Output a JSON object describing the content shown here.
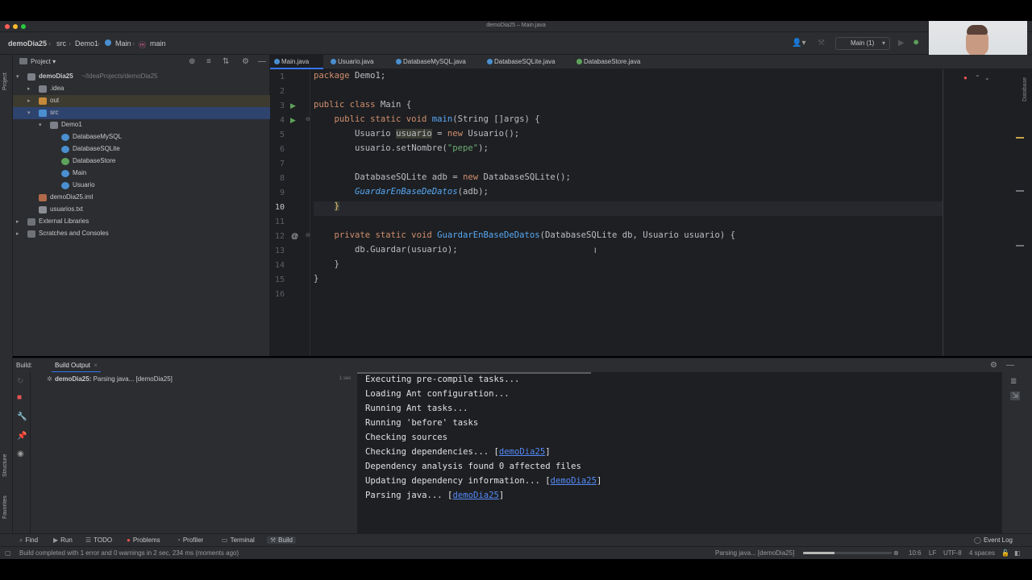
{
  "window": {
    "title": "demoDia25 – Main.java"
  },
  "navbar": {
    "breadcrumbs": [
      "demoDia25",
      "src",
      "Demo1",
      "Main",
      "main"
    ],
    "run_config": "Main (1)"
  },
  "left_strip": {
    "top_labels": [
      "Project"
    ],
    "bottom_labels": [
      "Structure",
      "Favorites"
    ]
  },
  "right_strip": {
    "labels": [
      "Database"
    ]
  },
  "project_panel": {
    "title": "Project",
    "tree": [
      {
        "label": "demoDia25",
        "sub": "~/IdeaProjects/demoDia25",
        "icon": "folder-icon"
      },
      {
        "label": ".idea",
        "icon": "folder-icon"
      },
      {
        "label": "out",
        "icon": "folder-icon"
      },
      {
        "label": "src",
        "icon": "folder-icon"
      },
      {
        "label": "Demo1",
        "icon": "package-icon"
      },
      {
        "label": "DatabaseMySQL",
        "icon": "class-icon"
      },
      {
        "label": "DatabaseSQLite",
        "icon": "class-icon"
      },
      {
        "label": "DatabaseStore",
        "icon": "interface-icon"
      },
      {
        "label": "Main",
        "icon": "class-icon"
      },
      {
        "label": "Usuario",
        "icon": "class-icon"
      },
      {
        "label": "demoDia25.iml",
        "icon": "module-file-icon"
      },
      {
        "label": "usuarios.txt",
        "icon": "text-file-icon"
      },
      {
        "label": "External Libraries",
        "icon": "library-icon"
      },
      {
        "label": "Scratches and Consoles",
        "icon": "scratch-icon"
      }
    ]
  },
  "editor": {
    "tabs": [
      {
        "label": "Main.java",
        "active": true
      },
      {
        "label": "Usuario.java",
        "active": false
      },
      {
        "label": "DatabaseMySQL.java",
        "active": false
      },
      {
        "label": "DatabaseSQLite.java",
        "active": false
      },
      {
        "label": "DatabaseStore.java",
        "active": false
      }
    ],
    "line_numbers": [
      "1",
      "2",
      "3",
      "4",
      "5",
      "6",
      "7",
      "8",
      "9",
      "10",
      "11",
      "12",
      "13",
      "14",
      "15",
      "16"
    ],
    "current_line": "10",
    "code": {
      "l1_kw": "package",
      "l1_rest": " Demo1;",
      "l3_kw": "public class",
      "l3_rest": " Main {",
      "l4_kw": "public static void",
      "l4_fn": "main",
      "l4_rest": "(String []args) {",
      "l5_a": "Usuario ",
      "l5_var": "usuario",
      "l5_b": " = ",
      "l5_kw": "new",
      "l5_c": " Usuario();",
      "l6_a": "usuario.setNombre(",
      "l6_str": "\"pepe\"",
      "l6_b": ");",
      "l8_a": "DatabaseSQLite adb = ",
      "l8_kw": "new",
      "l8_b": " DatabaseSQLite();",
      "l9_fn": "GuardarEnBaseDeDatos",
      "l9_rest": "(adb);",
      "l10": "}",
      "l12_kw": "private static void",
      "l12_fn": "GuardarEnBaseDeDatos",
      "l12_rest": "(DatabaseSQLite db, Usuario usuario) {",
      "l13": "db.Guardar(usuario);",
      "l14": "}",
      "l15": "}"
    }
  },
  "build": {
    "label": "Build:",
    "tab": "Build Output",
    "tree_item": "demoDia25:",
    "tree_item_detail": "Parsing java... [demoDia25]",
    "time": "1 sec",
    "console_lines": [
      {
        "text": "Executing pre-compile tasks...",
        "link": "",
        "after": ""
      },
      {
        "text": "Loading Ant configuration...",
        "link": "",
        "after": ""
      },
      {
        "text": "Running Ant tasks...",
        "link": "",
        "after": ""
      },
      {
        "text": "Running 'before' tasks",
        "link": "",
        "after": ""
      },
      {
        "text": "Checking sources",
        "link": "",
        "after": ""
      },
      {
        "text": "Checking dependencies... [",
        "link": "demoDia25",
        "after": "]"
      },
      {
        "text": "Dependency analysis found 0 affected files",
        "link": "",
        "after": ""
      },
      {
        "text": "Updating dependency information... [",
        "link": "demoDia25",
        "after": "]"
      },
      {
        "text": "Parsing java... [",
        "link": "demoDia25",
        "after": "]"
      }
    ]
  },
  "bottom_tools": [
    {
      "label": "Find",
      "icon": "search-icon",
      "active": false
    },
    {
      "label": "Run",
      "icon": "play-icon",
      "active": false
    },
    {
      "label": "TODO",
      "icon": "list-icon",
      "active": false
    },
    {
      "label": "Problems",
      "icon": "error-icon",
      "active": false
    },
    {
      "label": "Profiler",
      "icon": "profiler-icon",
      "active": false
    },
    {
      "label": "Terminal",
      "icon": "terminal-icon",
      "active": false
    },
    {
      "label": "Build",
      "icon": "hammer-icon",
      "active": true
    },
    {
      "label": "Event Log",
      "icon": "event-log-icon",
      "active": false
    }
  ],
  "status": {
    "message": "Build completed with 1 error and 0 warnings in 2 sec, 234 ms (moments ago)",
    "task": "Parsing java... [demoDia25]",
    "task_progress": 0.35,
    "position": "10:6",
    "line_sep": "LF",
    "encoding": "UTF-8",
    "indent": "4 spaces"
  },
  "colors": {
    "accent": "#3574f0",
    "editor_bg": "#1e1f22",
    "panel_bg": "#2b2d30",
    "keyword": "#cf8e6d",
    "function": "#56a8f5",
    "string": "#6aab73",
    "link": "#548af7",
    "error": "#e55353",
    "run_green": "#5ea35b"
  }
}
